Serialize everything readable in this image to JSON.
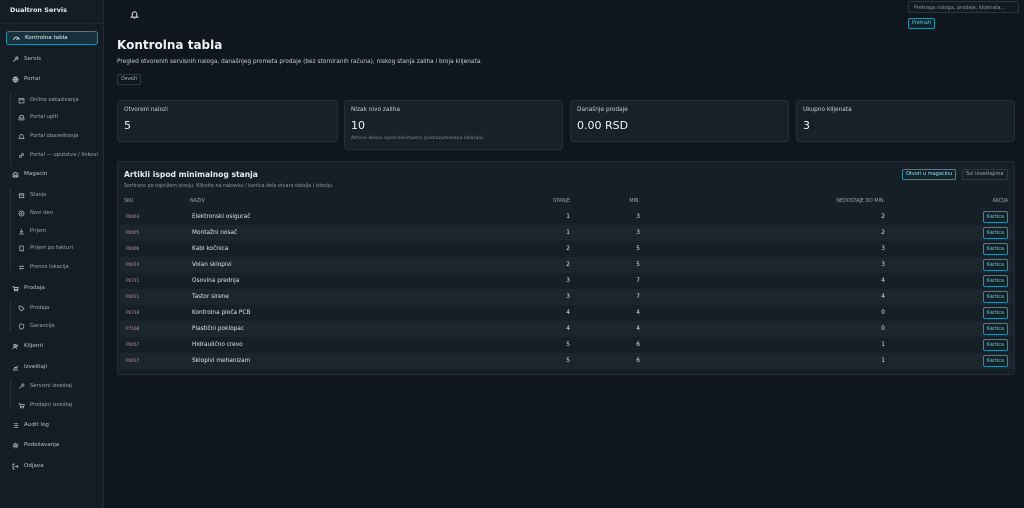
{
  "brand": "Dualtron Servis",
  "nav": [
    {
      "label": "Kontrolna tabla",
      "icon": "gauge-icon",
      "active": true
    },
    {
      "label": "Servis",
      "icon": "wrench-icon"
    },
    {
      "label": "Portal",
      "icon": "globe-icon"
    },
    {
      "label": "Online zakazivanja",
      "icon": "calendar-icon",
      "sub": true
    },
    {
      "label": "Portal upiti",
      "icon": "inbox-icon",
      "sub": true
    },
    {
      "label": "Portal obaveštenja",
      "icon": "bell-icon",
      "sub": true
    },
    {
      "label": "Portal — uputstva / linkovi",
      "icon": "link-icon",
      "sub": true
    },
    {
      "label": "Magacin",
      "icon": "warehouse-icon"
    },
    {
      "label": "Stanje",
      "icon": "box-icon",
      "sub": true
    },
    {
      "label": "Novi deo",
      "icon": "plus-icon",
      "sub": true
    },
    {
      "label": "Prijem",
      "icon": "download-icon",
      "sub": true
    },
    {
      "label": "Prijem po fakturi",
      "icon": "receipt-icon",
      "sub": true
    },
    {
      "label": "Prenos lokacija",
      "icon": "arrows-icon",
      "sub": true
    },
    {
      "label": "Prodaja",
      "icon": "cart-icon"
    },
    {
      "label": "Prodaja",
      "icon": "tag-icon",
      "sub": true
    },
    {
      "label": "Garancije",
      "icon": "shield-icon",
      "sub": true
    },
    {
      "label": "Klijenti",
      "icon": "users-icon"
    },
    {
      "label": "Izveštaji",
      "icon": "chart-icon"
    },
    {
      "label": "Servisni izveštaj",
      "icon": "wrench-icon",
      "sub": true
    },
    {
      "label": "Prodajni izveštaj",
      "icon": "cart-icon",
      "sub": true
    },
    {
      "label": "Audit log",
      "icon": "list-icon"
    },
    {
      "label": "Podešavanja",
      "icon": "gear-icon"
    },
    {
      "label": "Odjava",
      "icon": "logout-icon"
    }
  ],
  "topbar": {
    "search_placeholder": "Pretraga naloga, prodaje, klijenata...",
    "search_button": "Pretraži"
  },
  "page": {
    "title": "Kontrolna tabla",
    "subtitle": "Pregled otvorenih servisnih naloga, današnjeg prometa prodaje (bez storniranih računa), niskog stanja zaliha i broja klijenata.",
    "refresh": "Osveži"
  },
  "cards": [
    {
      "label": "Otvoreni nalozi",
      "value": "5",
      "note": ""
    },
    {
      "label": "Nizak nivo zaliha",
      "value": "10",
      "note": "Aktivni delovi ispod minimuma (podrazumevana lokacija)"
    },
    {
      "label": "Današnje prodaje",
      "value": "0.00 RSD",
      "note": ""
    },
    {
      "label": "Ukupno klijenata",
      "value": "3",
      "note": ""
    }
  ],
  "panel": {
    "title": "Artikli ispod minimalnog stanja",
    "subtitle": "Sortirano po najnižem stanju. Kliknite na nabavku / kartica dela otvara detalje i istoriju.",
    "btn_open": "Otvori u magacinu",
    "btn_reports": "Svi izveštajima",
    "headers": {
      "sku": "SKU",
      "name": "NAZIV",
      "stanje": "STANJE",
      "min": "MIN.",
      "missing": "NEDOSTAJE DO MIN.",
      "actions": "AKCIJA"
    },
    "action_label": "Kartica",
    "rows": [
      {
        "sku": "P0003",
        "name": "Elektronski osigurač",
        "stanje": "1",
        "min": "3",
        "missing": "2"
      },
      {
        "sku": "P0005",
        "name": "Montažni nosač",
        "stanje": "1",
        "min": "3",
        "missing": "2"
      },
      {
        "sku": "P0006",
        "name": "Kabl kočnica",
        "stanje": "2",
        "min": "5",
        "missing": "3"
      },
      {
        "sku": "P0074",
        "name": "Volan sklopivi",
        "stanje": "2",
        "min": "5",
        "missing": "3"
      },
      {
        "sku": "P0711",
        "name": "Osovina prednja",
        "stanje": "3",
        "min": "7",
        "missing": "4"
      },
      {
        "sku": "P0011",
        "name": "Tastor sirene",
        "stanje": "3",
        "min": "7",
        "missing": "4"
      },
      {
        "sku": "P0718",
        "name": "Kontrolna ploča PCB",
        "stanje": "4",
        "min": "4",
        "missing": "0"
      },
      {
        "sku": "P7108",
        "name": "Plastični poklopac",
        "stanje": "4",
        "min": "4",
        "missing": "0"
      },
      {
        "sku": "P0057",
        "name": "Hidraulično crevo",
        "stanje": "5",
        "min": "6",
        "missing": "1"
      },
      {
        "sku": "P0017",
        "name": "Sklopivi mehanizam",
        "stanje": "5",
        "min": "6",
        "missing": "1"
      }
    ]
  }
}
